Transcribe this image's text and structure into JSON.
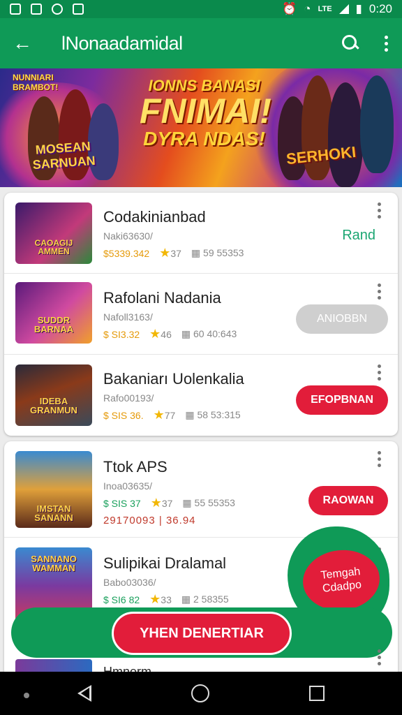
{
  "status_bar": {
    "time": "0:20"
  },
  "app_bar": {
    "title": "lNonaadamidal"
  },
  "banner": {
    "tag_left": "NUNNIARI\nBRAMBOT!",
    "headline_1": "IONNS BANASI",
    "headline_2": "FNIMAI!",
    "headline_3": "DYRA NDAS!",
    "logo_left": "MOSEAN\nSARNUAN",
    "logo_right": "SERHOKI"
  },
  "list_1": [
    {
      "thumb_label": "CAOAGIJ\nAMMEN",
      "name": "Codakinianbad",
      "sub": "Naki63630/",
      "price": "$5339.342",
      "rating": "37",
      "size": "59 55353",
      "action": {
        "type": "text",
        "label": "Rand"
      }
    },
    {
      "thumb_label": "SUDDR\nBARNAA",
      "name": "Rafolani Nadania",
      "sub": "Nafoll3163/",
      "price": "$ SI3.32",
      "rating": "46",
      "size": "60 40:643",
      "action": {
        "type": "grey",
        "label": "ANIOBBN"
      }
    },
    {
      "thumb_label": "IDEBA\nGRANMUN",
      "name": "Bakaniarı Uolenkalia",
      "sub": "Rafo00193/",
      "price": "$ SIS 36.",
      "rating": "77",
      "size": "58 53:315",
      "action": {
        "type": "red",
        "label": "EFOPBNAN"
      }
    }
  ],
  "list_2": [
    {
      "thumb_label": "IMSTAN\nSANANN",
      "name": "Ttok APS",
      "sub": "Inoa03635/",
      "price": "$ SIS 37",
      "rating": "37",
      "size": "55 55353",
      "extra": "29170093 | 36.94",
      "action": {
        "type": "red",
        "label": "RAOWAN"
      }
    },
    {
      "thumb_label": "SANNANO\nWAMMAN",
      "name": "Sulipikai Dralamal",
      "sub": "Babo03036/",
      "price": "$ SI6 82",
      "rating": "33",
      "size": "2 58355",
      "action": {
        "type": "none",
        "label": ""
      }
    }
  ],
  "fab": {
    "label": "Temgah\nCdadpo"
  },
  "cta": {
    "label": "YHEN DENERTIAR"
  },
  "peek_item": {
    "name": "Hmnerm..."
  },
  "colors": {
    "primary": "#0f9a57",
    "status_bar": "#0a8a4c",
    "accent_red": "#e21d3a",
    "rating_star": "#f2b705"
  }
}
